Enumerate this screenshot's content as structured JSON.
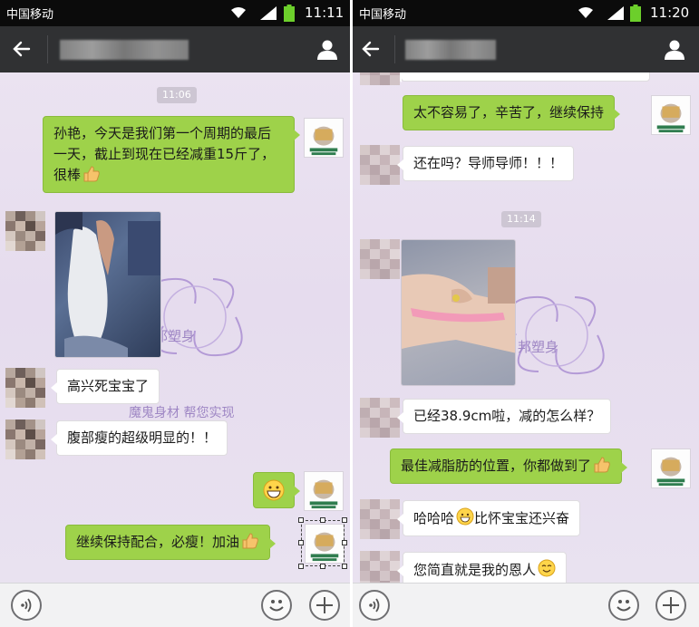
{
  "left": {
    "status": {
      "carrier": "中国移动",
      "time": "11:11"
    },
    "time_badge": "11:06",
    "messages": [
      {
        "side": "out",
        "text": "孙艳，今天是我们第一个周期的最后一天，截止到现在已经减重15斤了，很棒",
        "emoji": "thumbs-up-emoji"
      },
      {
        "side": "in",
        "type": "image",
        "image": "waist-photo"
      },
      {
        "side": "in",
        "text": "高兴死宝宝了"
      },
      {
        "side": "in",
        "text": "腹部瘦的超级明显的！！"
      },
      {
        "side": "out",
        "type": "emoji",
        "emoji": "grinning-emoji"
      },
      {
        "side": "out",
        "text": "继续保持配合，必瘦！加油",
        "emoji": "thumbs-up-emoji"
      }
    ],
    "watermark": {
      "line1": "邦塑身",
      "line2": "魔鬼身材    帮您实现"
    }
  },
  "right": {
    "status": {
      "time": "11:20"
    },
    "time_badge": "11:14",
    "messages": [
      {
        "side": "out",
        "text": "太不容易了，辛苦了，继续保持"
      },
      {
        "side": "in",
        "text": "还在吗？导师导师！！！"
      },
      {
        "side": "in",
        "type": "image",
        "image": "arm-measuring-tape-photo"
      },
      {
        "side": "in",
        "text": "已经38.9cm啦，减的怎么样？"
      },
      {
        "side": "out",
        "text": "最佳减脂肪的位置，你都做到了",
        "emoji": "thumbs-up-emoji"
      },
      {
        "side": "in",
        "text": "哈哈哈",
        "emoji": "grinning-emoji",
        "text2": "比怀宝宝还兴奋"
      },
      {
        "side": "in",
        "text": "您简直就是我的恩人",
        "emoji": "smile-emoji"
      }
    ],
    "watermark": {
      "line1": "邦塑身"
    }
  },
  "colors": {
    "outgoing_bubble": "#9ed24a",
    "incoming_bubble": "#ffffff",
    "title_bar": "#303133",
    "status_bar": "#0b0b0b",
    "chat_background": "#e9e1ef",
    "battery": "#6ccf2b"
  },
  "icons": [
    "back-arrow-icon",
    "profile-icon",
    "wifi-icon",
    "signal-icon",
    "battery-icon",
    "voice-input-icon",
    "emoji-smiley-icon",
    "plus-icon"
  ]
}
